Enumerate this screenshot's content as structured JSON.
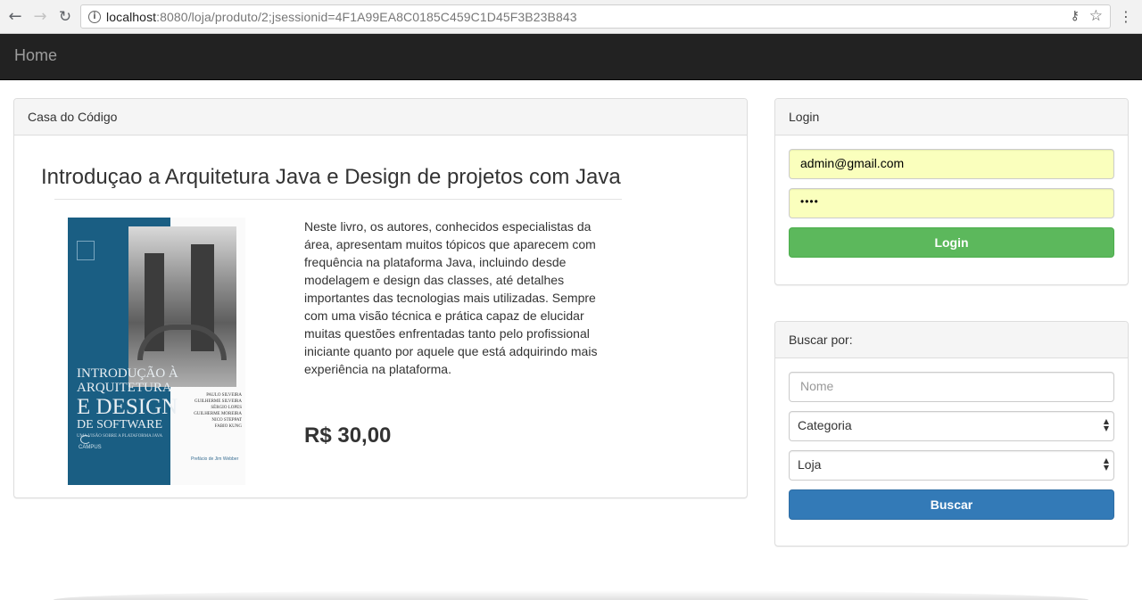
{
  "browser": {
    "url_host": "localhost",
    "url_rest": ":8080/loja/produto/2;jsessionid=4F1A99EA8C0185C459C1D45F3B23B843"
  },
  "navbar": {
    "brand": "Home"
  },
  "product_panel": {
    "heading": "Casa do Código",
    "title": "Introduçao a Arquitetura Java e Design de projetos com Java",
    "description": "Neste livro, os autores, conhecidos especialistas da área, apresentam muitos tópicos que aparecem com frequência na plataforma Java, incluindo desde modelagem e design das classes, até detalhes importantes das tecnologias mais utilizadas. Sempre com uma visão técnica e prática capaz de elucidar muitas questões enfrentadas tanto pelo profissional iniciante quanto por aquele que está adquirindo mais experiência na plataforma.",
    "price": "R$ 30,00",
    "cover": {
      "line1": "INTRODUÇÃO À",
      "line2": "ARQUITETURA",
      "line3": "E DESIGN",
      "line4": "DE SOFTWARE",
      "subtitle": "UMA VISÃO SOBRE A PLATAFORMA JAVA",
      "authors": [
        "PAULO SILVEIRA",
        "GUILHERME SILVEIRA",
        "SÉRGIO LOPES",
        "GUILHERME MOREIRA",
        "NICO STEPPAT",
        "FABIO KUNG"
      ],
      "publisher": "CAMPUS",
      "preface": "Prefácio de Jim Webber"
    }
  },
  "login_panel": {
    "heading": "Login",
    "email_value": "admin@gmail.com",
    "password_value": "••••",
    "button_label": "Login"
  },
  "search_panel": {
    "heading": "Buscar por:",
    "name_placeholder": "Nome",
    "category_selected": "Categoria",
    "store_selected": "Loja",
    "button_label": "Buscar"
  },
  "colors": {
    "navbar_bg": "#222222",
    "success": "#5cb85c",
    "primary": "#337ab7",
    "autofill": "#faffbd",
    "cover_blue": "#1a5e83"
  }
}
